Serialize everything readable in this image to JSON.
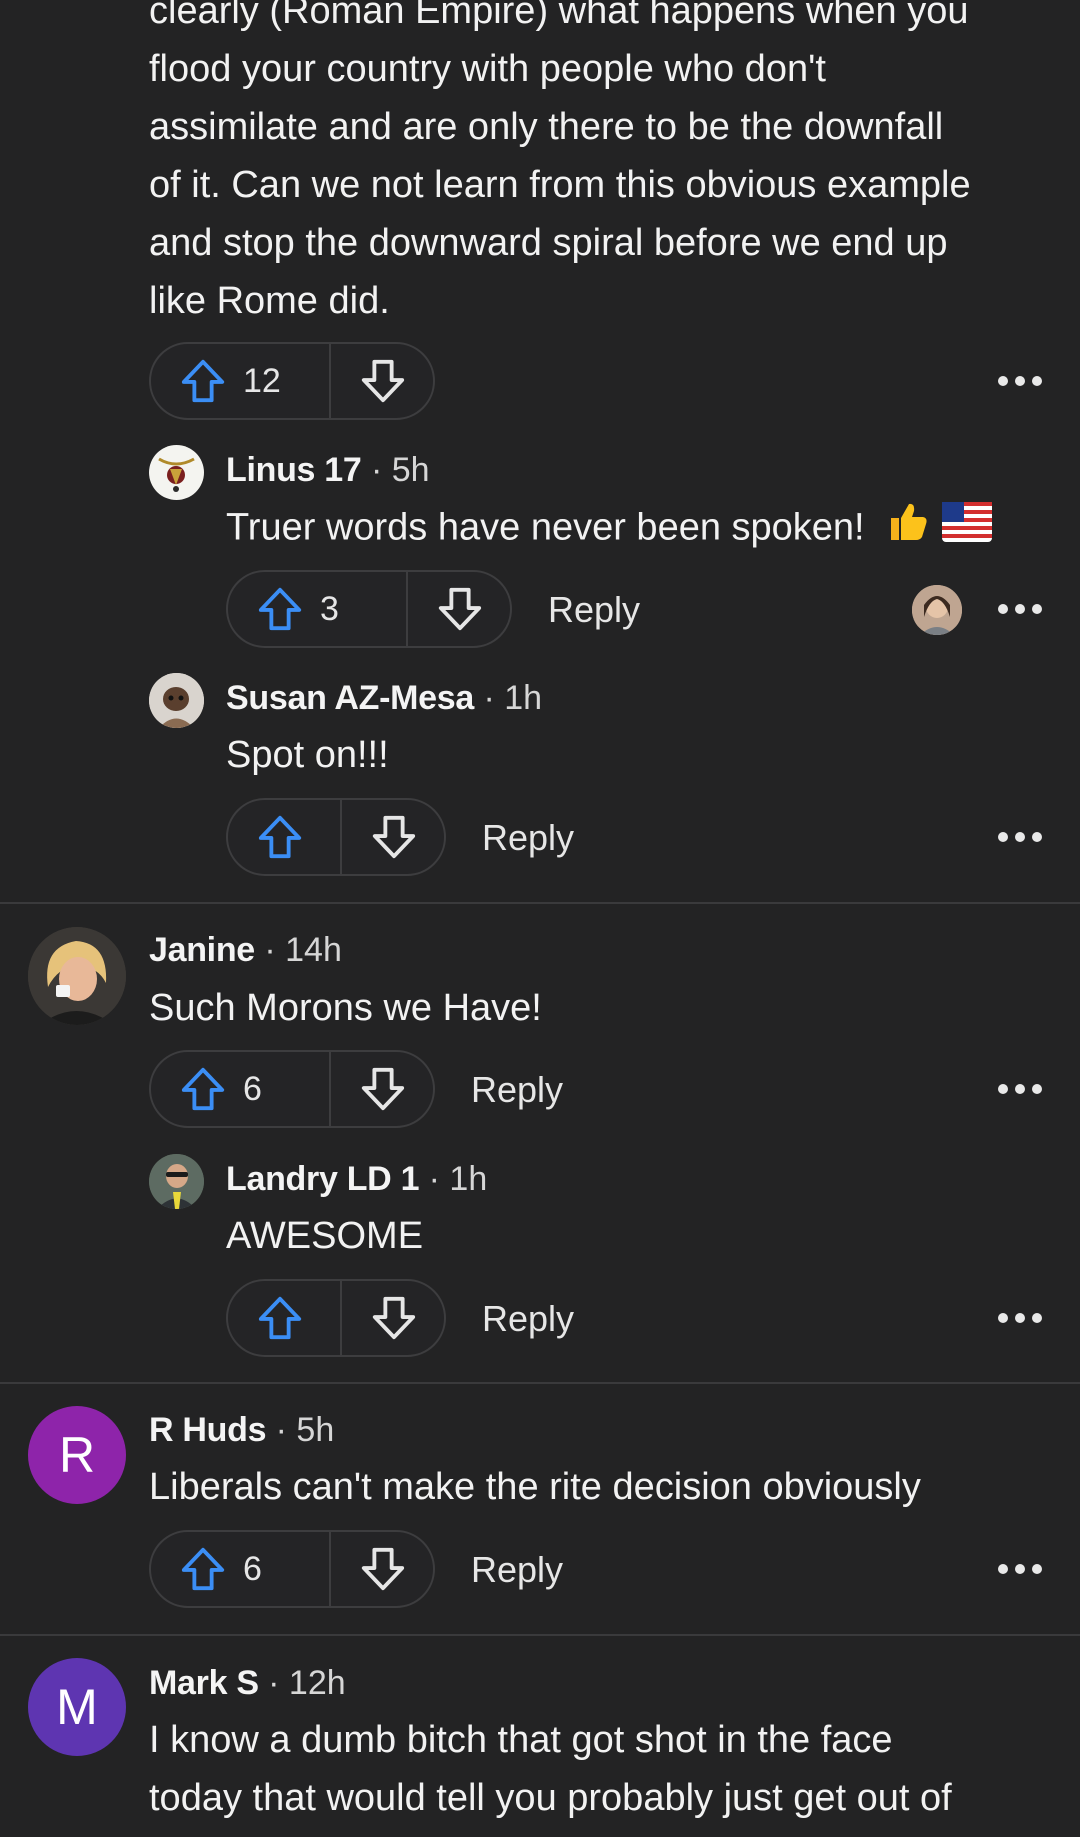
{
  "comments": [
    {
      "body_lines": [
        "clearly (Roman Empire) what happens when you",
        "flood your country with people who don't",
        "assimilate and are only there to be the downfall",
        "of it. Can we not learn from this obvious example",
        "and stop the downward spiral before we end up",
        "like Rome did."
      ],
      "upvotes": "12",
      "replies": [
        {
          "name": "Linus 17",
          "time": "· 5h",
          "text": "Truer words have never been spoken!",
          "upvotes": "3",
          "reply_label": "Reply"
        },
        {
          "name": "Susan AZ-Mesa",
          "time": "· 1h",
          "text": "Spot on!!!",
          "upvotes": "",
          "reply_label": "Reply"
        }
      ]
    },
    {
      "name": "Janine",
      "time": "· 14h",
      "text": "Such Morons we Have!",
      "upvotes": "6",
      "reply_label": "Reply",
      "replies": [
        {
          "name": "Landry LD 1",
          "time": "· 1h",
          "text": "AWESOME",
          "upvotes": "",
          "reply_label": "Reply"
        }
      ]
    },
    {
      "name": "R Huds",
      "time": "· 5h",
      "avatar_letter": "R",
      "avatar_color": "#8e24aa",
      "text": "Liberals can't make the rite decision obviously",
      "upvotes": "6",
      "reply_label": "Reply"
    },
    {
      "name": "Mark S",
      "time": "· 12h",
      "avatar_letter": "M",
      "avatar_color": "#5e35b1",
      "body_lines": [
        "I know a dumb bitch that got shot in the face",
        "today that would tell you probably just get out of"
      ]
    }
  ],
  "icons": {
    "upvote": "arrow-up-outline-icon",
    "downvote": "arrow-down-outline-icon",
    "more": "more-horizontal-icon"
  },
  "colors": {
    "background": "#232324",
    "upvote_blue": "#3b8ef5",
    "divider": "#3a3a3c"
  }
}
